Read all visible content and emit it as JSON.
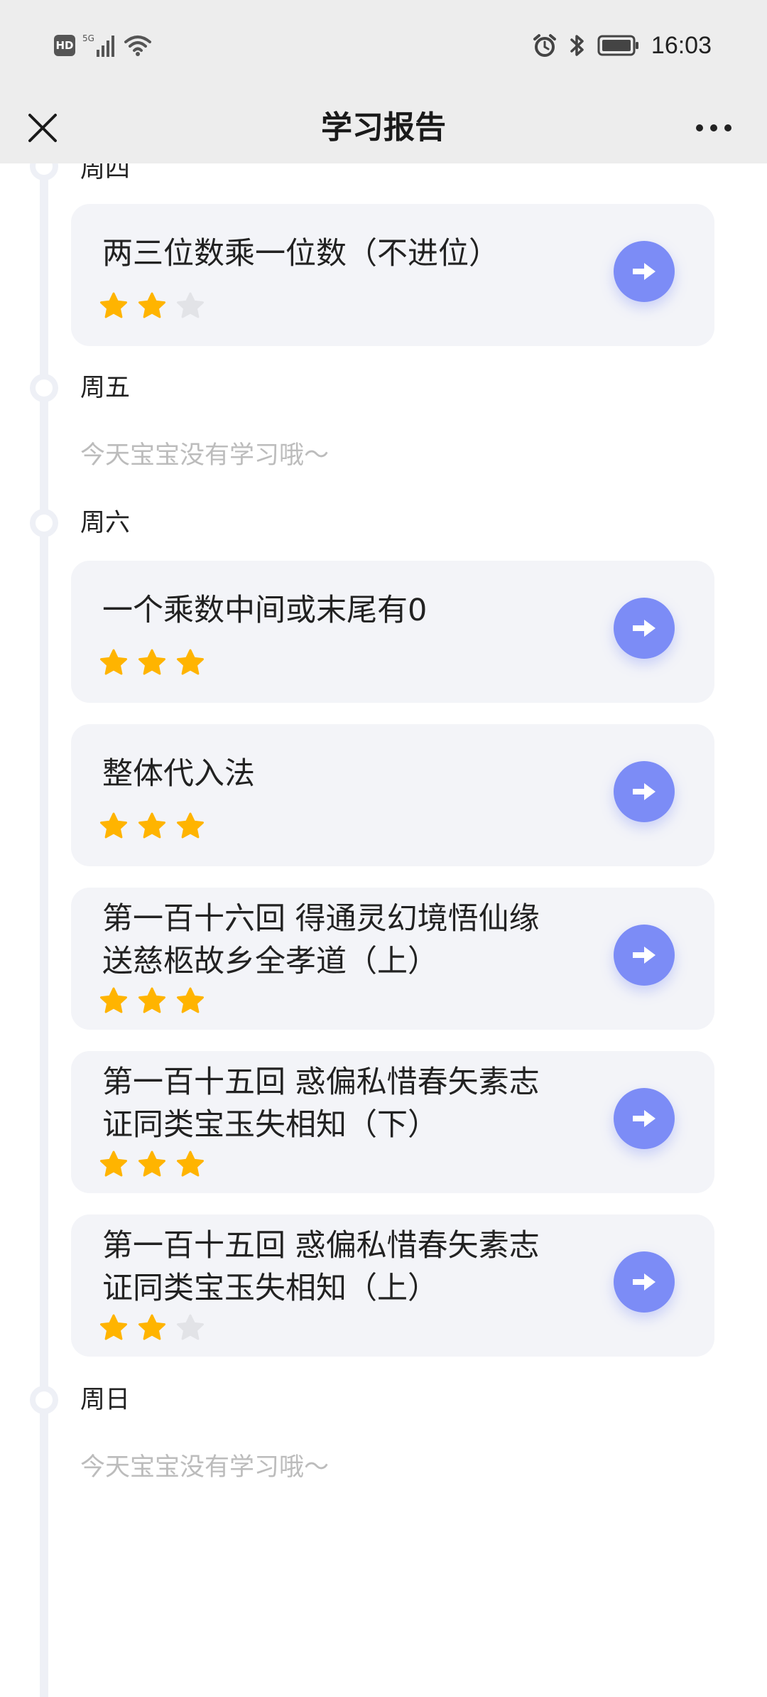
{
  "status_bar": {
    "hd": "HD",
    "signal_label": "5G",
    "time": "16:03"
  },
  "header": {
    "title": "学习报告",
    "close_icon": "close-icon",
    "more_icon": "more-icon"
  },
  "days": [
    {
      "label": "周四",
      "lessons": [
        {
          "title": "两三位数乘一位数（不进位）",
          "stars": 2,
          "max_stars": 3
        }
      ]
    },
    {
      "label": "周五",
      "empty_text": "今天宝宝没有学习哦～"
    },
    {
      "label": "周六",
      "lessons": [
        {
          "title": "一个乘数中间或末尾有0",
          "stars": 3,
          "max_stars": 3
        },
        {
          "title": "整体代入法",
          "stars": 3,
          "max_stars": 3
        },
        {
          "title_line1": "第一百十六回 得通灵幻境悟仙缘",
          "title_line2": "送慈柩故乡全孝道（上）",
          "stars": 3,
          "max_stars": 3
        },
        {
          "title_line1": "第一百十五回 惑偏私惜春矢素志",
          "title_line2": "证同类宝玉失相知（下）",
          "stars": 3,
          "max_stars": 3
        },
        {
          "title_line1": "第一百十五回 惑偏私惜春矢素志",
          "title_line2": "证同类宝玉失相知（上）",
          "stars": 2,
          "max_stars": 3
        }
      ]
    },
    {
      "label": "周日",
      "empty_text": "今天宝宝没有学习哦～"
    }
  ],
  "colors": {
    "star_filled": "#ffb400",
    "star_empty": "#e2e3e7",
    "action_button": "#7c8cf6",
    "card_bg": "#f3f4f8",
    "timeline": "#eef0f6"
  }
}
